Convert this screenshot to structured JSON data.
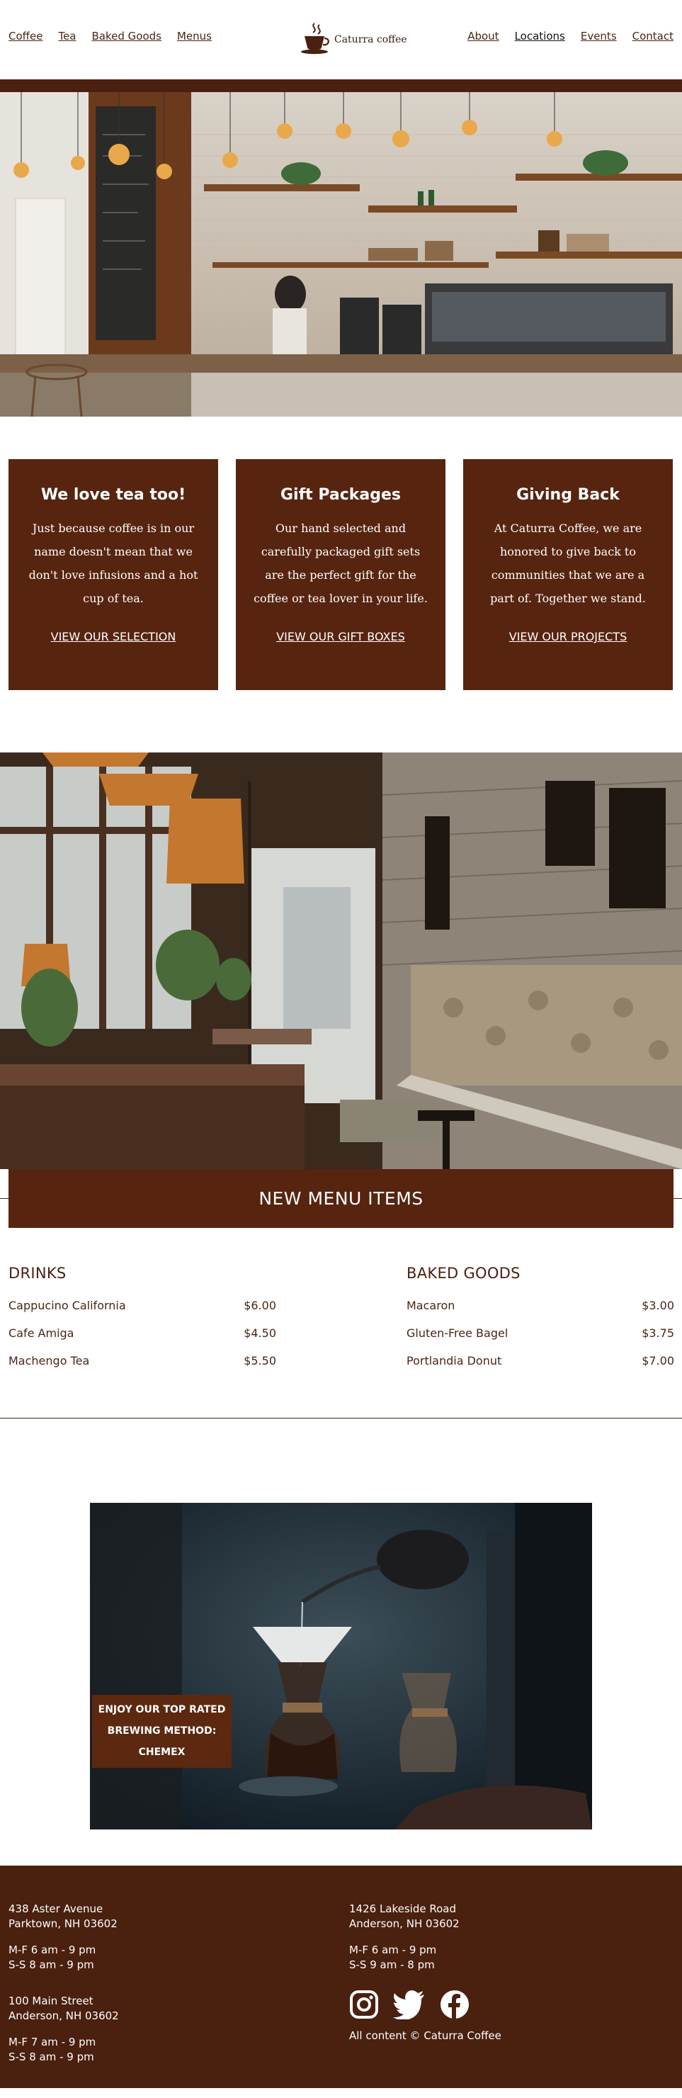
{
  "nav": {
    "left": [
      "Coffee",
      "Tea",
      "Baked Goods",
      "Menus"
    ],
    "right": [
      "About",
      "Locations",
      "Events",
      "Contact"
    ]
  },
  "logo": {
    "text": "Caturra coffee"
  },
  "cards": [
    {
      "title": "We love tea too!",
      "text": "Just because coffee is in our name doesn't mean that we don't love infusions and a hot cup of tea.",
      "link": "VIEW OUR SELECTION"
    },
    {
      "title": "Gift Packages",
      "text": "Our hand selected and carefully packaged gift sets are the perfect gift for the coffee or tea lover in your life.",
      "link": "VIEW OUR GIFT BOXES"
    },
    {
      "title": "Giving Back",
      "text": "At Caturra Coffee, we are honored to give back to communities that we are a part of. Together we stand.",
      "link": "VIEW OUR PROJECTS"
    }
  ],
  "menu": {
    "banner": "NEW MENU ITEMS",
    "drinks": {
      "heading": "DRINKS",
      "items": [
        {
          "name": "Cappucino California",
          "price": "$6.00"
        },
        {
          "name": "Cafe Amiga",
          "price": "$4.50"
        },
        {
          "name": "Machengo Tea",
          "price": "$5.50"
        }
      ]
    },
    "baked": {
      "heading": "BAKED GOODS",
      "items": [
        {
          "name": "Macaron",
          "price": "$3.00"
        },
        {
          "name": "Gluten-Free Bagel",
          "price": "$3.75"
        },
        {
          "name": "Portlandia Donut",
          "price": "$7.00"
        }
      ]
    }
  },
  "brew": {
    "line1": "ENJOY OUR TOP RATED",
    "line2": "BREWING METHOD:",
    "line3": "CHEMEX"
  },
  "footer": {
    "loc1": {
      "street": "438 Aster Avenue",
      "city": "Parktown, NH 03602",
      "weekday": "M-F 6 am - 9 pm",
      "weekend": "S-S 8 am - 9 pm"
    },
    "loc2": {
      "street": "1426 Lakeside Road",
      "city": "Anderson, NH 03602",
      "weekday": "M-F 6 am - 9 pm",
      "weekend": "S-S 9 am - 8 pm"
    },
    "loc3": {
      "street": "100 Main Street",
      "city": "Anderson, NH 03602",
      "weekday": "M-F 7 am - 9 pm",
      "weekend": "S-S 8 am - 9 pm"
    },
    "copyright": "All content © Caturra Coffee"
  },
  "icons": [
    "coffee-cup-icon",
    "instagram-icon",
    "twitter-icon",
    "facebook-icon"
  ],
  "colors": {
    "brand_brown": "#572410",
    "footer_brown": "#4a200f",
    "text_brown": "#4a2515"
  }
}
